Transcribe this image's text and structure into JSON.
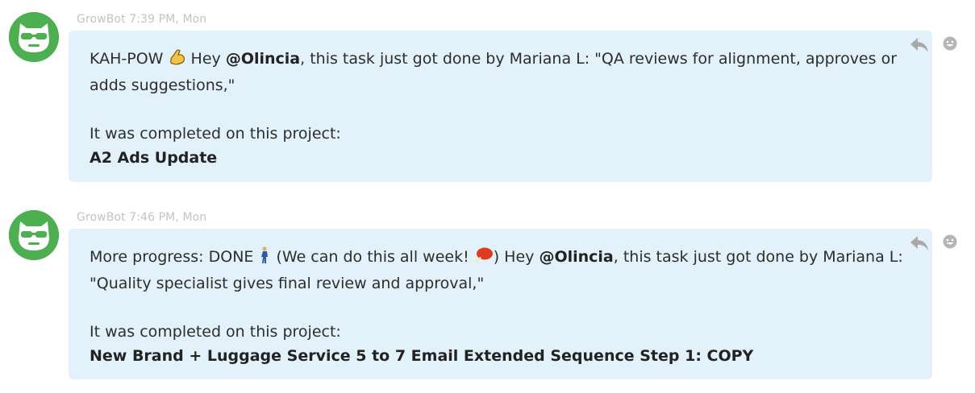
{
  "messages": [
    {
      "sender": "GrowBot",
      "time": "7:39 PM, Mon",
      "line1_a": "KAH-POW",
      "line1_emoji": "flexed-biceps-emoji",
      "line1_b": " Hey ",
      "mention": "@Olincia",
      "line1_c": ", this task just got done by Mariana L: \"QA reviews for alignment, approves or",
      "line2": "adds suggestions,\"",
      "completed_label": "It was completed on this project:",
      "project": "A2 Ads Update"
    },
    {
      "sender": "GrowBot",
      "time": "7:46 PM, Mon",
      "line1_a": "More progress: DONE",
      "line1_emoji1": "person-walking-emoji",
      "line1_b": " (We can do this all week! ",
      "line1_emoji2": "meat-on-bone-emoji",
      "line1_c": ") Hey ",
      "mention": "@Olincia",
      "line1_d": ", this task just got done by Mariana L:",
      "line2": "\"Quality specialist gives final review and approval,\"",
      "completed_label": "It was completed on this project:",
      "project": "New Brand + Luggage Service 5 to 7 Email Extended Sequence Step 1: COPY"
    }
  ],
  "icons": {
    "avatar": "growbot-avatar-icon",
    "reply": "reply-icon",
    "reaction": "emoji-reaction-icon"
  },
  "colors": {
    "bubble_bg": "#e2f1fa",
    "avatar_green": "#4caf50",
    "meta_text": "#c3c3c3",
    "icon_gray": "#a9a9a9"
  }
}
